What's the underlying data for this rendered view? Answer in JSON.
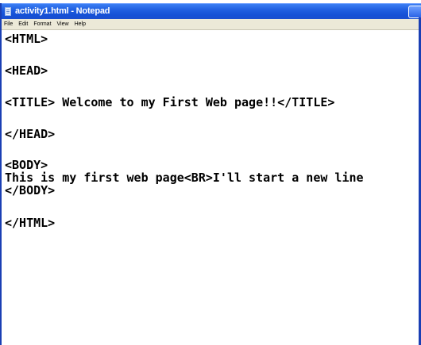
{
  "window": {
    "title": "activity1.html - Notepad"
  },
  "menu": {
    "items": [
      "File",
      "Edit",
      "Format",
      "View",
      "Help"
    ]
  },
  "document": {
    "lines": [
      "<HTML>",
      "",
      "<HEAD>",
      "",
      "<TITLE> Welcome to my First Web page!!</TITLE>",
      "",
      "</HEAD>",
      "",
      "<BODY>",
      "This is my first web page<BR>I'll start a new line",
      "</BODY>",
      "",
      "</HTML>"
    ]
  },
  "icons": {
    "app": "notepad-icon",
    "minimize": "minimize-icon"
  }
}
